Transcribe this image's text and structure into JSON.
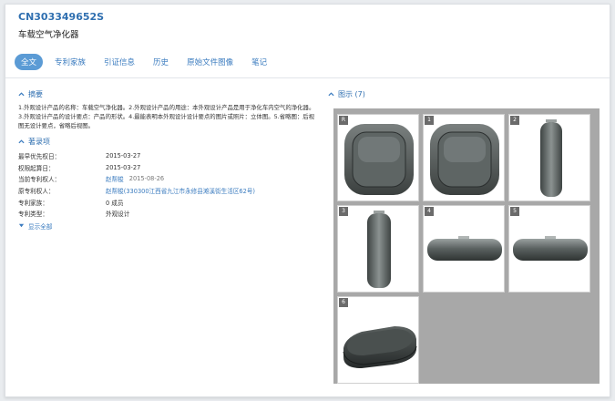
{
  "header": {
    "pub_number": "CN303349652S",
    "title": "车载空气净化器"
  },
  "tabs": [
    {
      "label": "全文",
      "active": true
    },
    {
      "label": "专利家族",
      "active": false
    },
    {
      "label": "引证信息",
      "active": false
    },
    {
      "label": "历史",
      "active": false
    },
    {
      "label": "原始文件图像",
      "active": false
    },
    {
      "label": "笔记",
      "active": false
    }
  ],
  "abstract": {
    "heading": "摘要",
    "text": "1.外观设计产品的名称：车载空气净化器。2.外观设计产品的用途：本外观设计产品是用于净化车内空气的净化器。3.外观设计产品的设计要点：产品的形状。4.最能表明本外观设计设计要点的图片或照片：立体图。5.省略图：后视图无设计要点，省略后视图。"
  },
  "info": {
    "heading": "著录项",
    "rows": [
      {
        "label": "最早优先权日：",
        "value": "2015-03-27",
        "link": false
      },
      {
        "label": "权限起算日：",
        "value": "2015-03-27",
        "link": false
      },
      {
        "label": "当前专利权人：",
        "value": "赵帮梭",
        "date": "2015-08-26",
        "link": true
      },
      {
        "label": "原专利权人：",
        "value": "赵帮梭(330300江西省九江市永修县滩溪街生活区62号)",
        "link": true
      },
      {
        "label": "专利家族：",
        "value": "0 成员",
        "link": false
      },
      {
        "label": "专利类型：",
        "value": "外观设计",
        "link": false
      }
    ],
    "show_all": "显示全部"
  },
  "figures": {
    "heading": "图示 (7)",
    "thumbs": [
      {
        "label": "R",
        "view": "front"
      },
      {
        "label": "1",
        "view": "front"
      },
      {
        "label": "2",
        "view": "side"
      },
      {
        "label": "3",
        "view": "side"
      },
      {
        "label": "4",
        "view": "top"
      },
      {
        "label": "5",
        "view": "top"
      },
      {
        "label": "6",
        "view": "perspective"
      }
    ]
  },
  "colors": {
    "accent": "#3a7bbf",
    "active_tab_bg": "#5b9bd5",
    "panel_bg": "#a8a8a8"
  }
}
